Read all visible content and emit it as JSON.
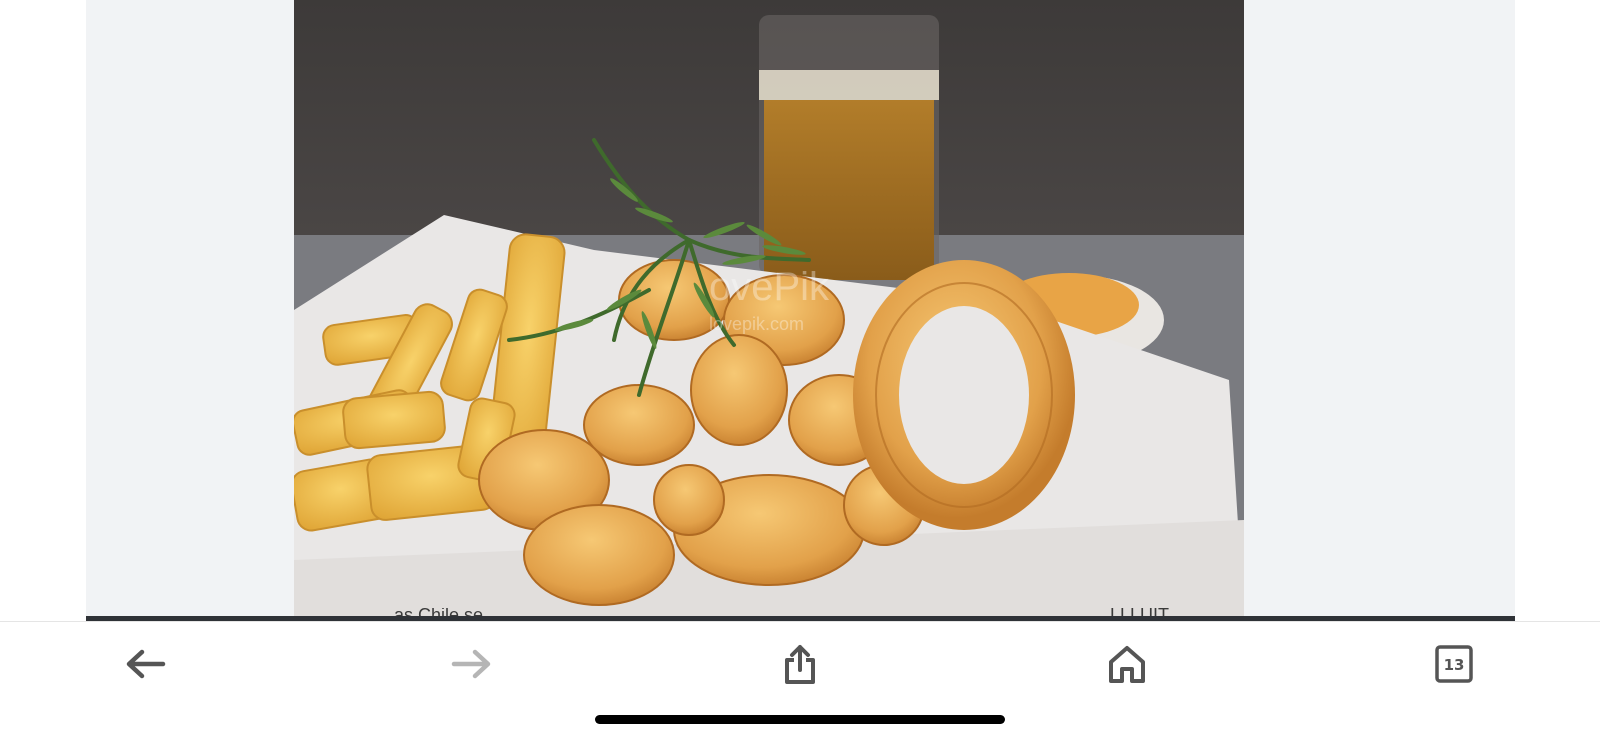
{
  "viewer": {
    "image_alt": "Fried calamari and chicken pieces with french fries, rosemary sprig and a glass of beer",
    "watermark_line1": "ovePik",
    "watermark_line2": "lovepik.com"
  },
  "page_fragments": {
    "left": "as Chile se",
    "right": "LLLUIT"
  },
  "toolbar": {
    "back_icon": "back-arrow-icon",
    "forward_icon": "forward-arrow-icon",
    "share_icon": "share-icon",
    "home_icon": "home-icon",
    "tabs_icon": "tabs-icon",
    "tab_count": "13",
    "active_color": "#555555",
    "disabled_color": "#b5b5b5"
  }
}
